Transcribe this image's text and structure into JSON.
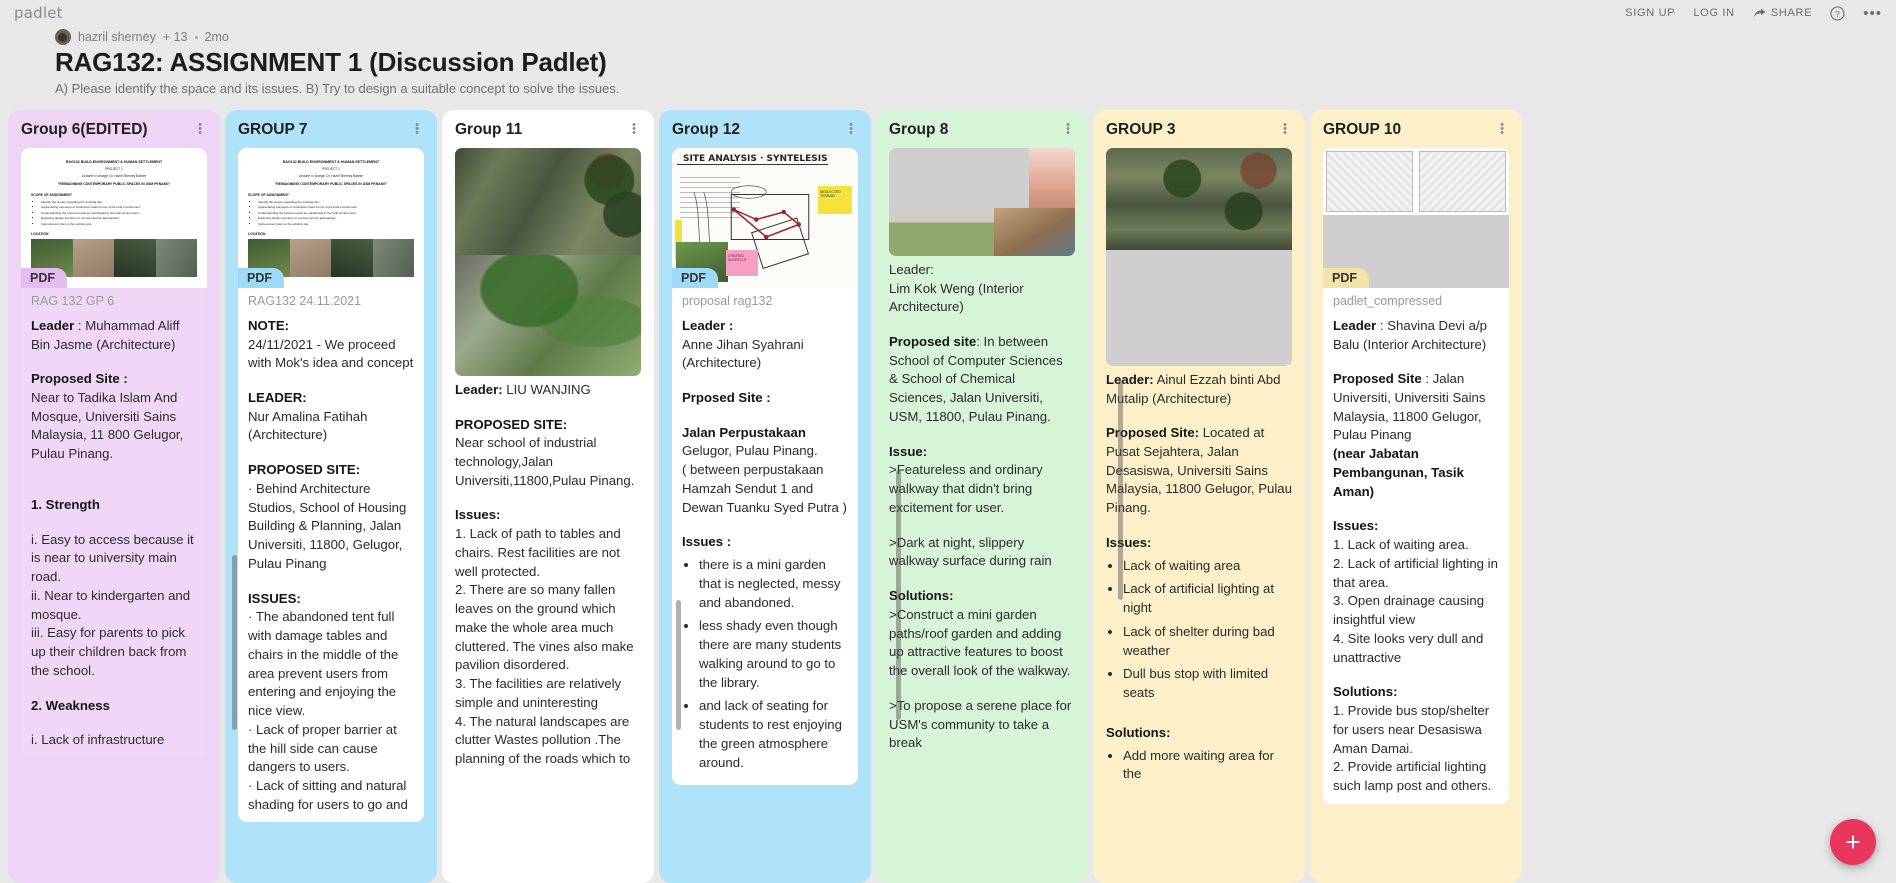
{
  "topbar": {
    "brand": "padlet",
    "sign_up": "SIGN UP",
    "log_in": "LOG IN",
    "share": "SHARE",
    "help_icon": "question-circle-icon",
    "more_icon": "ellipsis-icon"
  },
  "header": {
    "author": "hazril sherney",
    "collaborators": "+ 13",
    "time": "2mo",
    "title": "RAG132: ASSIGNMENT 1 (Discussion Padlet)",
    "description": "A) Please identify the space and its issues. B) Try to design a suitable concept to solve the issues."
  },
  "fab": {
    "label": "+",
    "color": "#e8365d"
  },
  "columns": [
    {
      "id": "group-6-edited",
      "title": "Group 6(EDITED)",
      "bg": "#eed4f5",
      "card_bg": "#f0d7f7",
      "badge_bg": "#e2bdee",
      "filename": "RAG 132 GP 6",
      "has_pdf": true,
      "pdf_label": "PDF",
      "body": [
        {
          "type": "p",
          "bold": "Leader",
          "text": " : Muhammad Aliff Bin Jasme (Architecture)"
        },
        {
          "type": "sp"
        },
        {
          "type": "p",
          "bold": "Proposed Site :",
          "text": ""
        },
        {
          "type": "p",
          "text": "Near to Tadika Islam And Mosque, Universiti Sains Malaysia, 11 800 Gelugor, Pulau Pinang."
        },
        {
          "type": "sp"
        },
        {
          "type": "sp"
        },
        {
          "type": "p",
          "bold": "1.   Strength",
          "text": ""
        },
        {
          "type": "sp"
        },
        {
          "type": "p",
          "text": "i.                    Easy to access because it is near to university main road."
        },
        {
          "type": "p",
          "text": "ii.                   Near to kindergarten and mosque."
        },
        {
          "type": "p",
          "text": "iii.              Easy for parents to pick up their children back from the school."
        },
        {
          "type": "sp"
        },
        {
          "type": "p",
          "bold": "2.   Weakness",
          "text": ""
        },
        {
          "type": "sp"
        },
        {
          "type": "p",
          "text": "i.                    Lack of infrastructure"
        }
      ]
    },
    {
      "id": "group-7",
      "title": "GROUP 7",
      "bg": "#aee3fa",
      "card_bg": "#ffffff",
      "badge_bg": "#9ddaf7",
      "filename": "RAG132 24.11.2021",
      "has_pdf": true,
      "pdf_label": "PDF",
      "body": [
        {
          "type": "p",
          "bold": "NOTE:",
          "text": ""
        },
        {
          "type": "p",
          "text": "24/11/2021 - We proceed with Mok's idea and concept"
        },
        {
          "type": "sp"
        },
        {
          "type": "p",
          "bold": "LEADER:",
          "text": ""
        },
        {
          "type": "p",
          "text": "Nur Amalina Fatihah (Architecture)"
        },
        {
          "type": "sp"
        },
        {
          "type": "p",
          "bold": "PROPOSED SITE:",
          "text": ""
        },
        {
          "type": "p",
          "text": "·              Behind Architecture Studios, School of Housing Building & Planning, Jalan Universiti, 11800, Gelugor, Pulau Pinang"
        },
        {
          "type": "sp"
        },
        {
          "type": "p",
          "bold": "ISSUES:",
          "text": ""
        },
        {
          "type": "p",
          "text": "·              The abandoned tent full with damage tables and chairs in the middle of the area prevent users from entering and enjoying the nice view."
        },
        {
          "type": "p",
          "text": "·              Lack of proper barrier at the hill side can cause dangers to users."
        },
        {
          "type": "p",
          "text": "·              Lack of sitting and natural shading for users to go and"
        }
      ]
    },
    {
      "id": "group-11",
      "title": "Group 11",
      "bg": "#ffffff",
      "card_bg": "#ffffff",
      "badge_bg": "#e6e6e6",
      "filename": "",
      "has_pdf": false,
      "pdf_label": "",
      "body": [
        {
          "type": "p",
          "bold": "Leader:",
          "text": " LIU WANJING"
        },
        {
          "type": "sp"
        },
        {
          "type": "p",
          "bold": "PROPOSED SITE:",
          "text": ""
        },
        {
          "type": "p",
          "text": "     Near school of industrial technology,Jalan Universiti,11800,Pulau Pinang."
        },
        {
          "type": "sp"
        },
        {
          "type": "p",
          "bold": "Issues:",
          "text": ""
        },
        {
          "type": "p",
          "text": "1.   Lack of path to tables and chairs. Rest facilities are not well protected."
        },
        {
          "type": "p",
          "text": "2.   There are so many fallen leaves on the ground which make the whole area much cluttered. The vines also make pavilion disordered."
        },
        {
          "type": "p",
          "text": "3.   The facilities are relatively simple and uninteresting"
        },
        {
          "type": "p",
          "text": "4.   The natural landscapes are clutter Wastes pollution .The planning of the roads which to"
        }
      ]
    },
    {
      "id": "group-12",
      "title": "Group 12",
      "bg": "#aee3fa",
      "card_bg": "#ffffff",
      "badge_bg": "#9ddaf7",
      "filename": "proposal rag132",
      "has_pdf": true,
      "pdf_label": "PDF",
      "body": [
        {
          "type": "p",
          "bold": "Leader :",
          "text": ""
        },
        {
          "type": "p",
          "text": "Anne Jihan Syahrani (Architecture)"
        },
        {
          "type": "sp"
        },
        {
          "type": "p",
          "bold": "Prposed Site :",
          "text": ""
        },
        {
          "type": "sp"
        },
        {
          "type": "p",
          "bold": "Jalan Perpustakaan",
          "text": ""
        },
        {
          "type": "p",
          "text": "Gelugor, Pulau Pinang."
        },
        {
          "type": "p",
          "text": "( between perpustakaan Hamzah Sendut 1 and Dewan Tuanku Syed Putra )"
        },
        {
          "type": "sp"
        },
        {
          "type": "p",
          "bold": "Issues :",
          "text": ""
        },
        {
          "type": "ul",
          "items": [
            "there is a mini garden that is neglected, messy and abandoned.",
            "less shady even though there are many students walking around to go to the library.",
            "and lack of seating for students to rest enjoying the green atmosphere around."
          ]
        }
      ]
    },
    {
      "id": "group-8",
      "title": "Group 8",
      "bg": "#d6f5d6",
      "card_bg": "#d6f5d6",
      "badge_bg": "#c3eec3",
      "filename": "",
      "has_pdf": false,
      "pdf_label": "",
      "body": [
        {
          "type": "p",
          "text": "Leader:"
        },
        {
          "type": "p",
          "text": "Lim Kok Weng (Interior Architecture)"
        },
        {
          "type": "sp"
        },
        {
          "type": "p",
          "bold": "Proposed site",
          "text": ": In between School of Computer Sciences & School of Chemical Sciences,  Jalan Universiti, USM, 11800, Pulau Pinang."
        },
        {
          "type": "sp"
        },
        {
          "type": "p",
          "bold": "Issue:",
          "text": ""
        },
        {
          "type": "p",
          "text": ">Featureless and ordinary walkway that didn't bring excitement for user."
        },
        {
          "type": "sp"
        },
        {
          "type": "p",
          "text": ">Dark at night, slippery walkway surface during rain"
        },
        {
          "type": "sp"
        },
        {
          "type": "p",
          "bold": "Solutions:",
          "text": ""
        },
        {
          "type": "p",
          "text": ">Construct a mini garden paths/roof garden and adding up attractive features to  boost the overall look of the walkway."
        },
        {
          "type": "sp"
        },
        {
          "type": "p",
          "text": ">To propose a serene place for USM's community to take a break"
        }
      ]
    },
    {
      "id": "group-3",
      "title": "GROUP 3",
      "bg": "#fdf0c9",
      "card_bg": "#fdf0c9",
      "badge_bg": "#f5e3ab",
      "filename": "",
      "has_pdf": false,
      "pdf_label": "",
      "body": [
        {
          "type": "p",
          "bold": "Leader:",
          "text": " Ainul Ezzah binti Abd Mutalip (Architecture)"
        },
        {
          "type": "sp"
        },
        {
          "type": "p",
          "bold": "Proposed Site:",
          "text": " Located at Pusat Sejahtera, Jalan Desasiswa, Universiti Sains Malaysia, 11800 Gelugor, Pulau Pinang."
        },
        {
          "type": "sp"
        },
        {
          "type": "p",
          "bold": "Issues:",
          "text": ""
        },
        {
          "type": "ul",
          "items": [
            "Lack of waiting area",
            "Lack of artificial lighting at night",
            "Lack of shelter during bad weather",
            "Dull bus stop with limited seats"
          ]
        },
        {
          "type": "sp"
        },
        {
          "type": "p",
          "bold": "Solutions:",
          "text": ""
        },
        {
          "type": "ul",
          "items": [
            "Add more waiting area for the"
          ]
        }
      ]
    },
    {
      "id": "group-10",
      "title": "GROUP 10",
      "bg": "#fdf0c9",
      "card_bg": "#ffffff",
      "badge_bg": "#f5e3ab",
      "filename": "padlet_compressed",
      "has_pdf": true,
      "pdf_label": "PDF",
      "body": [
        {
          "type": "p",
          "bold": "Leader",
          "text": " : Shavina Devi a/p Balu (Interior Architecture)"
        },
        {
          "type": "sp"
        },
        {
          "type": "p",
          "bold": "Proposed Site",
          "text": " : Jalan Universiti, Universiti Sains Malaysia, 11800 Gelugor, Pulau Pinang "
        },
        {
          "type": "p",
          "bold": "(near Jabatan Pembangunan, Tasik Aman)",
          "text": ""
        },
        {
          "type": "sp"
        },
        {
          "type": "p",
          "bold": "Issues:",
          "text": ""
        },
        {
          "type": "p",
          "text": "1. Lack of waiting area."
        },
        {
          "type": "p",
          "text": "2. Lack of artificial lighting in that area."
        },
        {
          "type": "p",
          "text": "3. Open drainage causing insightful view"
        },
        {
          "type": "p",
          "text": "4. Site looks very dull and unattractive"
        },
        {
          "type": "sp"
        },
        {
          "type": "p",
          "bold": "Solutions:",
          "text": ""
        },
        {
          "type": "p",
          "text": "1. Provide bus stop/shelter for users near Desasiswa Aman Damai."
        },
        {
          "type": "p",
          "text": "2. Provide artificial lighting such lamp post and others."
        }
      ]
    }
  ],
  "pdf_doc": {
    "line1": "RAG132 BUILD ENVIRONMENT & HUMAN SETTLEMENT",
    "line2": "PROJECT 1",
    "line3": "Lecturer In charge: Dr. Hazril Sherney Basher",
    "line4": "\"REIMAGINING CONTEMPORARY PUBLIC SPACES IN USM PENANG\"",
    "scope_heading": "SCOPE OF ASSIGNMENT",
    "scope_items": [
      "Identify the issues regarding the existing site.",
      "Appreciating elements of production basic forms of the built environment.",
      "Understanding the human needs as manifested in the built environment.",
      "Exploring design intention or concept and its approaches.",
      "Improvement plan to the existing site"
    ],
    "location_heading": "LOCATION"
  },
  "site_analysis": {
    "title": "SITE ANALYSIS · SYNTELESIS",
    "note_yellow": "NEGLECTED TERRAIN",
    "note_pink": "CREATED SHORTCUT"
  }
}
